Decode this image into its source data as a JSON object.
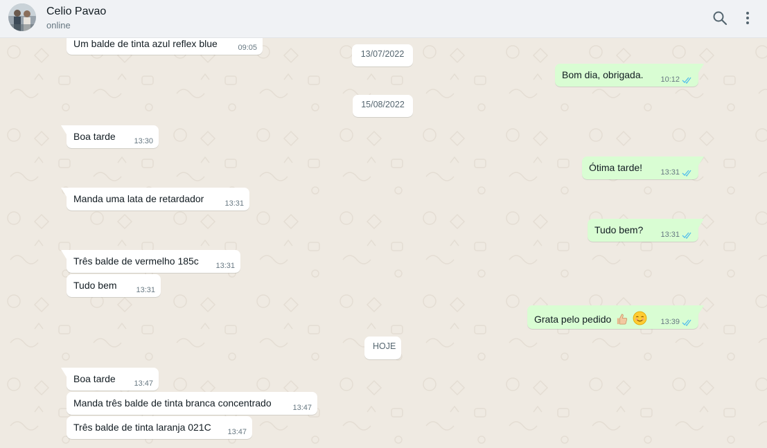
{
  "header": {
    "contact_name": "Celio Pavao",
    "status": "online",
    "search_icon": "search-icon",
    "menu_icon": "menu-dots-icon"
  },
  "colors": {
    "incoming_bubble": "#ffffff",
    "outgoing_bubble": "#d9fdd3",
    "read_ticks": "#53bdeb",
    "chat_background": "#efeae2"
  },
  "messages": {
    "m1": {
      "text": "Um balde de tinta azul reflex blue",
      "time": "09:05"
    },
    "d1": "13/07/2022",
    "m2": {
      "text": "Bom dia, obrigada.",
      "time": "10:12"
    },
    "d2": "15/08/2022",
    "m3": {
      "text": "Boa tarde",
      "time": "13:30"
    },
    "m4": {
      "text": "Ótima tarde!",
      "time": "13:31"
    },
    "m5": {
      "text": "Manda uma lata de retardador",
      "time": "13:31"
    },
    "m6": {
      "text": "Tudo bem?",
      "time": "13:31"
    },
    "m7": {
      "text": "Três balde de vermelho 185c",
      "time": "13:31"
    },
    "m8": {
      "text": "Tudo bem",
      "time": "13:31"
    },
    "m9": {
      "text": "Grata pelo pedido",
      "time": "13:39",
      "emojis": [
        "thumbs-up-emoji",
        "smiling-face-emoji"
      ]
    },
    "d3": "HOJE",
    "m10": {
      "text": "Boa tarde",
      "time": "13:47"
    },
    "m11": {
      "text": "Manda três balde de tinta branca concentrado",
      "time": "13:47"
    },
    "m12": {
      "text": "Três balde de tinta laranja 021C",
      "time": "13:47"
    }
  }
}
